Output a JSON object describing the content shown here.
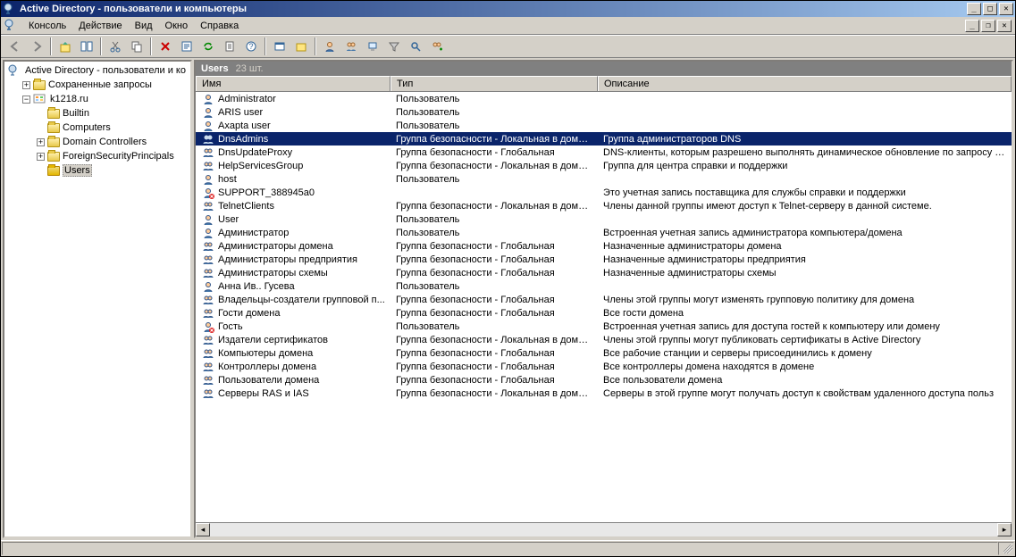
{
  "window_title": "Active Directory - пользователи и компьютеры",
  "menu": [
    "Консоль",
    "Действие",
    "Вид",
    "Окно",
    "Справка"
  ],
  "tree": {
    "root": "Active Directory - пользователи и ко",
    "saved_queries": "Сохраненные запросы",
    "domain": "k1218.ru",
    "children": [
      "Builtin",
      "Computers",
      "Domain Controllers",
      "ForeignSecurityPrincipals",
      "Users"
    ]
  },
  "panel": {
    "title": "Users",
    "count": "23 шт."
  },
  "columns": {
    "name": "Имя",
    "type": "Тип",
    "desc": "Описание"
  },
  "items": [
    {
      "icon": "user",
      "name": "Administrator",
      "type": "Пользователь",
      "desc": ""
    },
    {
      "icon": "user",
      "name": "ARIS user",
      "type": "Пользователь",
      "desc": ""
    },
    {
      "icon": "user",
      "name": "Axapta user",
      "type": "Пользователь",
      "desc": ""
    },
    {
      "icon": "group",
      "name": "DnsAdmins",
      "type": "Группа безопасности - Локальная в домене",
      "desc": "Группа администраторов DNS",
      "selected": true
    },
    {
      "icon": "group",
      "name": "DnsUpdateProxy",
      "type": "Группа безопасности - Глобальная",
      "desc": "DNS-клиенты, которым разрешено выполнять динамическое обновление по запросу дру"
    },
    {
      "icon": "group",
      "name": "HelpServicesGroup",
      "type": "Группа безопасности - Локальная в домене",
      "desc": "Группа для центра справки и поддержки"
    },
    {
      "icon": "user",
      "name": "host",
      "type": "Пользователь",
      "desc": ""
    },
    {
      "icon": "userx",
      "name": "SUPPORT_388945a0",
      "type": "",
      "desc": "Это учетная запись поставщика для службы справки и поддержки"
    },
    {
      "icon": "group",
      "name": "TelnetClients",
      "type": "Группа безопасности - Локальная в домене",
      "desc": "Члены данной группы имеют доступ к Telnet-серверу в данной системе."
    },
    {
      "icon": "user",
      "name": "User",
      "type": "Пользователь",
      "desc": ""
    },
    {
      "icon": "user",
      "name": "Администратор",
      "type": "Пользователь",
      "desc": "Встроенная учетная запись администратора компьютера/домена"
    },
    {
      "icon": "group",
      "name": "Администраторы домена",
      "type": "Группа безопасности - Глобальная",
      "desc": "Назначенные администраторы домена"
    },
    {
      "icon": "group",
      "name": "Администраторы предприятия",
      "type": "Группа безопасности - Глобальная",
      "desc": "Назначенные администраторы предприятия"
    },
    {
      "icon": "group",
      "name": "Администраторы схемы",
      "type": "Группа безопасности - Глобальная",
      "desc": "Назначенные администраторы схемы"
    },
    {
      "icon": "user",
      "name": "Анна Ив.. Гусева",
      "type": "Пользователь",
      "desc": ""
    },
    {
      "icon": "group",
      "name": "Владельцы-создатели групповой п...",
      "type": "Группа безопасности - Глобальная",
      "desc": "Члены этой группы могут изменять групповую политику для домена"
    },
    {
      "icon": "group",
      "name": "Гости домена",
      "type": "Группа безопасности - Глобальная",
      "desc": "Все гости домена"
    },
    {
      "icon": "userx",
      "name": "Гость",
      "type": "Пользователь",
      "desc": "Встроенная учетная запись для доступа гостей к компьютеру или домену"
    },
    {
      "icon": "group",
      "name": "Издатели сертификатов",
      "type": "Группа безопасности - Локальная в домене",
      "desc": "Члены этой группы могут публиковать сертификаты в Active Directory"
    },
    {
      "icon": "group",
      "name": "Компьютеры домена",
      "type": "Группа безопасности - Глобальная",
      "desc": "Все рабочие станции и серверы присоединились к домену"
    },
    {
      "icon": "group",
      "name": "Контроллеры домена",
      "type": "Группа безопасности - Глобальная",
      "desc": "Все контроллеры домена находятся в домене"
    },
    {
      "icon": "group",
      "name": "Пользователи домена",
      "type": "Группа безопасности - Глобальная",
      "desc": "Все пользователи домена"
    },
    {
      "icon": "group",
      "name": "Серверы RAS и IAS",
      "type": "Группа безопасности - Локальная в домене",
      "desc": "Серверы в этой группе могут получать доступ к свойствам удаленного доступа польз"
    }
  ]
}
